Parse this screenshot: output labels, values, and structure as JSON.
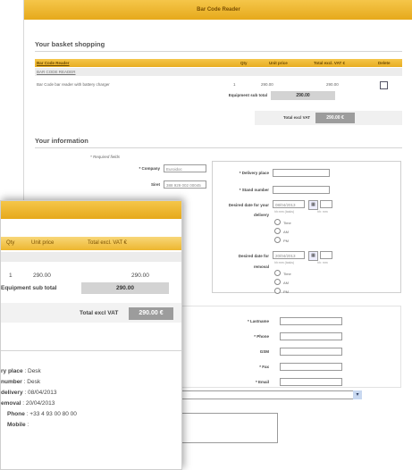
{
  "header": {
    "title": "Bar Code Reader"
  },
  "basket": {
    "title": "Your basket shopping",
    "columns": [
      "Bar Code Reader",
      "Qty",
      "Unit price",
      "Total excl. VAT €",
      "Delete"
    ],
    "category": "BAR CODE READER",
    "row": {
      "name": "Bar Code bar reader with battery charger",
      "qty": "1",
      "unit_price": "290.00",
      "total": "290.00"
    },
    "sub_total_label": "Equipment sub total",
    "sub_total_value": "290.00",
    "total_label": "Total excl VAT",
    "total_value": "290.00 €"
  },
  "info": {
    "title": "Your information",
    "required_note": "* Required fields",
    "company_label": "* Company",
    "company_value": "Euroidoc",
    "siret_label": "Siret",
    "siret_value": "388 929 002 00045",
    "delivery_place_label": "* Delivery place",
    "stand_number_label": "* Stand number",
    "delivery_date_label": "Desired date for your",
    "delivery_date_label2": "delivery",
    "delivery_date_value": "08/04/2013",
    "removal_date_label": "Desired date for",
    "removal_date_label2": "removal",
    "removal_date_value": "20/04/2013",
    "time_hint": "hh:mm (tasks)",
    "hh_mm": "hh: mm",
    "options": [
      "Time",
      "AM",
      "PM"
    ],
    "lastname_label": "* Lastname",
    "phone_label": "* Phone",
    "gsm_label": "GSM",
    "fax_label": "* Fax",
    "email_label": "* Email"
  },
  "zoom": {
    "columns": [
      "Qty",
      "Unit price",
      "Total excl. VAT €"
    ],
    "qty": "1",
    "unit_price": "290.00",
    "total": "290.00",
    "sub_total_label": "Equipment sub total",
    "sub_total_value": "290.00",
    "total_label": "Total excl VAT",
    "total_value": "290.00 €",
    "details": [
      {
        "label": "ry place",
        "value": "Desk"
      },
      {
        "label": "number",
        "value": "Desk"
      },
      {
        "label": "delivery",
        "value": "08/04/2013"
      },
      {
        "label": "emoval",
        "value": "20/04/2013"
      },
      {
        "label": "Phone",
        "value": "+33 4 93 00 80 00"
      },
      {
        "label": "Mobile",
        "value": ""
      }
    ]
  },
  "colors": {
    "accent": "#e8ad22",
    "total_bg": "#9c9c9c"
  }
}
